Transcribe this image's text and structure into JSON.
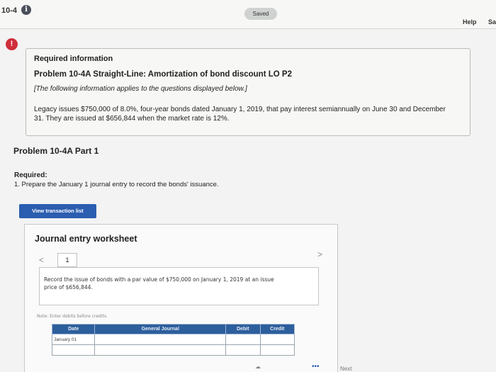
{
  "header": {
    "question_number": "10-4",
    "info_icon": "info-icon",
    "status_badge": "Saved",
    "help_label": "Help",
    "save_exit_label": "Sa"
  },
  "required_info": {
    "alert_icon": "!",
    "title": "Required information",
    "problem_title": "Problem 10-4A Straight-Line: Amortization of bond discount LO P2",
    "applies_note": "[The following information applies to the questions displayed below.]",
    "description": "Legacy issues $750,000 of 8.0%, four-year bonds dated January 1, 2019, that pay interest semiannually on June 30 and December 31. They are issued at $656,844 when the market rate is 12%."
  },
  "part": {
    "title": "Problem 10-4A Part 1",
    "required_label": "Required:",
    "required_text": "1. Prepare the January 1 journal entry to record the bonds' issuance."
  },
  "view_transaction_button": "View transaction list",
  "worksheet": {
    "title": "Journal entry worksheet",
    "prev_icon": "<",
    "page": "1",
    "next_icon": ">",
    "instruction": "Record the issue of bonds with a par value of $750,000 on January 1, 2019 at an issue price of $656,844.",
    "note": "Note: Enter debits before credits.",
    "table": {
      "headers": [
        "Date",
        "General Journal",
        "Debit",
        "Credit"
      ],
      "rows": [
        [
          "January 01",
          "",
          "",
          ""
        ],
        [
          "",
          "",
          "",
          ""
        ]
      ]
    }
  },
  "footer": {
    "next_label": "Next",
    "cloud_icon": "cloud-icon"
  }
}
